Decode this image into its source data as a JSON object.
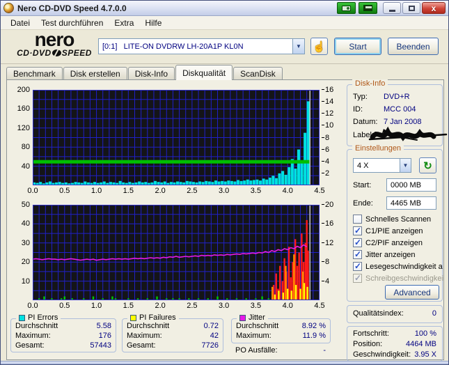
{
  "window": {
    "title": "Nero CD-DVD Speed 4.7.0.0"
  },
  "menu": {
    "items": [
      "Datei",
      "Test durchführen",
      "Extra",
      "Hilfe"
    ]
  },
  "toolbar": {
    "logo_line1": "nero",
    "logo_cd": "CD·DVD",
    "logo_speed": "SPEED",
    "drive_value": "[0:1]   LITE-ON DVDRW LH-20A1P KL0N",
    "eject_icon": "hand-icon",
    "start_label": "Start",
    "quit_label": "Beenden"
  },
  "tabs": [
    {
      "label": "Benchmark"
    },
    {
      "label": "Disk erstellen"
    },
    {
      "label": "Disk-Info"
    },
    {
      "label": "Diskqualität"
    },
    {
      "label": "ScanDisk"
    }
  ],
  "active_tab": "Diskqualität",
  "disk_info": {
    "title": "Disk-Info",
    "rows": [
      {
        "label": "Typ:",
        "value": "DVD+R"
      },
      {
        "label": "ID:",
        "value": "MCC 004"
      },
      {
        "label": "Datum:",
        "value": "7 Jan 2008"
      },
      {
        "label": "Label:",
        "value": "",
        "redacted": true
      }
    ]
  },
  "settings": {
    "title": "Einstellungen",
    "speed_value": "4 X",
    "start_label": "Start:",
    "start_value": "0000 MB",
    "end_label": "Ende:",
    "end_value": "4465 MB",
    "refresh_icon": "↻",
    "checkboxes": [
      {
        "label": "Schnelles Scannen",
        "checked": false,
        "disabled": false
      },
      {
        "label": "C1/PIE anzeigen",
        "checked": true,
        "disabled": false
      },
      {
        "label": "C2/PIF anzeigen",
        "checked": true,
        "disabled": false
      },
      {
        "label": "Jitter anzeigen",
        "checked": true,
        "disabled": false
      },
      {
        "label": "Lesegeschwindigkeit a",
        "checked": true,
        "disabled": false
      },
      {
        "label": "Schreibgeschwindigkei",
        "checked": true,
        "disabled": true
      }
    ],
    "advanced_label": "Advanced"
  },
  "quality": {
    "label": "Qualitätsindex:",
    "value": "0"
  },
  "progress": {
    "rows": [
      {
        "label": "Fortschritt:",
        "value": "100 %"
      },
      {
        "label": "Position:",
        "value": "4464 MB"
      },
      {
        "label": "Geschwindigkeit:",
        "value": "3.95 X"
      }
    ]
  },
  "stats": {
    "pi_errors": {
      "title": "PI Errors",
      "swatch": "#00e0e0",
      "rows": [
        {
          "label": "Durchschnitt",
          "value": "5.58"
        },
        {
          "label": "Maximum:",
          "value": "176"
        },
        {
          "label": "Gesamt:",
          "value": "57443"
        }
      ]
    },
    "pi_failures": {
      "title": "PI Failures",
      "swatch": "#ffff00",
      "rows": [
        {
          "label": "Durchschnitt",
          "value": "0.72"
        },
        {
          "label": "Maximum:",
          "value": "42"
        },
        {
          "label": "Gesamt:",
          "value": "7726"
        }
      ]
    },
    "jitter": {
      "title": "Jitter",
      "swatch": "#e61ae6",
      "rows": [
        {
          "label": "Durchschnitt",
          "value": "8.92 %"
        },
        {
          "label": "Maximum:",
          "value": "11.9 %"
        }
      ]
    },
    "po_label": "PO Ausfälle:",
    "po_value": "-"
  },
  "chart_data": [
    {
      "type": "bar",
      "title": "PI Errors and read speed vs. disc position",
      "x_unit": "GB",
      "xlim": [
        0,
        4.5
      ],
      "x_ticks": [
        0.0,
        0.5,
        1.0,
        1.5,
        2.0,
        2.5,
        3.0,
        3.5,
        4.0,
        4.5
      ],
      "grid_rows": 10,
      "bg": "#141418",
      "grid_color": "#2020c8",
      "border_color": "#3030c8",
      "left_axis": {
        "max": 200,
        "ticks": [
          200,
          160,
          120,
          80,
          40
        ]
      },
      "right_axis": {
        "max": 16,
        "ticks": [
          16,
          14,
          12,
          10,
          8,
          6,
          4,
          2
        ]
      },
      "series": [
        {
          "name": "pi-errors",
          "type": "bar",
          "axis": "left",
          "color": "#00e0e0",
          "step": 0.05,
          "values": [
            6,
            5,
            7,
            4,
            6,
            8,
            5,
            6,
            7,
            5,
            6,
            4,
            5,
            7,
            6,
            5,
            8,
            6,
            5,
            7,
            5,
            6,
            8,
            5,
            7,
            6,
            5,
            9,
            6,
            5,
            7,
            5,
            6,
            8,
            6,
            7,
            5,
            6,
            9,
            7,
            6,
            8,
            5,
            7,
            6,
            8,
            7,
            6,
            9,
            8,
            7,
            6,
            8,
            7,
            9,
            8,
            7,
            10,
            8,
            9,
            8,
            10,
            9,
            8,
            11,
            9,
            10,
            12,
            10,
            11,
            12,
            10,
            14,
            12,
            16,
            20,
            15,
            25,
            30,
            22,
            38,
            55,
            35,
            75,
            48,
            110,
            176
          ]
        },
        {
          "name": "read-speed",
          "type": "line",
          "axis": "right",
          "color": "#00be00",
          "width": 5,
          "points": [
            [
              0,
              3.95
            ],
            [
              4.35,
              3.95
            ]
          ]
        },
        {
          "name": "end-marker",
          "type": "vline",
          "x": 4.35,
          "color": "#c8c8c8",
          "width": 1.5
        }
      ]
    },
    {
      "type": "mixed",
      "title": "PI Failures and Jitter vs. disc position",
      "x_unit": "GB",
      "xlim": [
        0,
        4.5
      ],
      "x_ticks": [
        0.0,
        0.5,
        1.0,
        1.5,
        2.0,
        2.5,
        3.0,
        3.5,
        4.0,
        4.5
      ],
      "grid_rows": 10,
      "bg": "#141418",
      "grid_color": "#2020c8",
      "border_color": "#3030c8",
      "left_axis": {
        "max": 50,
        "ticks": [
          50,
          40,
          30,
          20,
          10
        ]
      },
      "right_axis": {
        "max": 20,
        "ticks": [
          20,
          16,
          12,
          8,
          4
        ]
      },
      "series": [
        {
          "name": "pi-failures",
          "type": "points",
          "axis": "left",
          "color": "#00c800",
          "points": [
            [
              0.1,
              1
            ],
            [
              0.18,
              2
            ],
            [
              0.3,
              1
            ],
            [
              0.45,
              1
            ],
            [
              0.5,
              2
            ],
            [
              0.62,
              1
            ],
            [
              0.8,
              1
            ],
            [
              0.95,
              2
            ],
            [
              1.1,
              1
            ],
            [
              1.25,
              2
            ],
            [
              1.3,
              1
            ],
            [
              1.5,
              1
            ],
            [
              1.65,
              1
            ],
            [
              1.8,
              1
            ],
            [
              1.95,
              2
            ],
            [
              2.1,
              1
            ],
            [
              2.2,
              1
            ],
            [
              2.3,
              1
            ],
            [
              2.45,
              1
            ],
            [
              2.6,
              1
            ],
            [
              2.75,
              1
            ],
            [
              2.9,
              2
            ],
            [
              3.05,
              1
            ],
            [
              3.2,
              1
            ],
            [
              3.35,
              1
            ],
            [
              3.5,
              1
            ],
            [
              3.6,
              2
            ],
            [
              3.7,
              1
            ]
          ]
        },
        {
          "name": "pif-burst-red",
          "type": "points",
          "axis": "left",
          "color": "#ff1a1a",
          "points": [
            [
              3.78,
              8
            ],
            [
              3.82,
              14
            ],
            [
              3.85,
              6
            ],
            [
              3.88,
              18
            ],
            [
              3.92,
              10
            ],
            [
              3.95,
              22
            ],
            [
              3.98,
              15
            ],
            [
              4.02,
              28
            ],
            [
              4.05,
              12
            ],
            [
              4.08,
              20
            ],
            [
              4.12,
              32
            ],
            [
              4.15,
              18
            ],
            [
              4.18,
              25
            ],
            [
              4.22,
              35
            ],
            [
              4.25,
              20
            ],
            [
              4.28,
              30
            ],
            [
              4.3,
              42
            ],
            [
              4.32,
              26
            ]
          ]
        },
        {
          "name": "pif-burst-orange",
          "type": "points",
          "axis": "left",
          "color": "#ff8c00",
          "points": [
            [
              3.76,
              7
            ],
            [
              3.97,
              18
            ],
            [
              4.1,
              24
            ],
            [
              4.24,
              15
            ]
          ]
        },
        {
          "name": "pif-burst-yellow",
          "type": "points",
          "axis": "left",
          "color": "#ffff00",
          "points": [
            [
              3.8,
              3
            ],
            [
              3.86,
              5
            ],
            [
              3.93,
              4
            ],
            [
              4.0,
              6
            ],
            [
              4.06,
              5
            ],
            [
              4.13,
              8
            ],
            [
              4.2,
              6
            ],
            [
              4.26,
              9
            ],
            [
              4.31,
              7
            ]
          ]
        },
        {
          "name": "jitter",
          "type": "line",
          "axis": "right",
          "color": "#e61ae6",
          "width": 1.6,
          "step": 0.05,
          "values": [
            8.6,
            8.7,
            8.6,
            8.5,
            8.6,
            8.7,
            8.6,
            8.6,
            8.5,
            8.6,
            8.5,
            8.6,
            8.7,
            8.6,
            8.5,
            8.4,
            8.5,
            8.6,
            8.5,
            8.6,
            8.4,
            8.5,
            8.6,
            8.5,
            8.6,
            8.7,
            8.6,
            8.7,
            8.6,
            8.7,
            8.6,
            8.7,
            8.8,
            8.7,
            8.8,
            8.7,
            8.8,
            8.9,
            8.8,
            8.9,
            8.8,
            9.0,
            8.9,
            9.1,
            9.0,
            9.2,
            9.0,
            9.1,
            9.2,
            9.1,
            9.2,
            9.3,
            9.2,
            9.4,
            9.3,
            9.4,
            9.3,
            9.5,
            9.4,
            9.5,
            9.4,
            9.6,
            9.5,
            9.6,
            9.7,
            9.6,
            9.8,
            9.7,
            9.8,
            9.9,
            9.8,
            10.0,
            9.9,
            10.2,
            10.0,
            10.4,
            10.2,
            10.6,
            10.4,
            10.8,
            10.6,
            11.0,
            10.8,
            11.3,
            11.0,
            11.6,
            11.2
          ]
        },
        {
          "name": "end-marker",
          "type": "vline",
          "x": 4.35,
          "color": "#c8c8c8",
          "width": 1.5
        }
      ]
    }
  ]
}
